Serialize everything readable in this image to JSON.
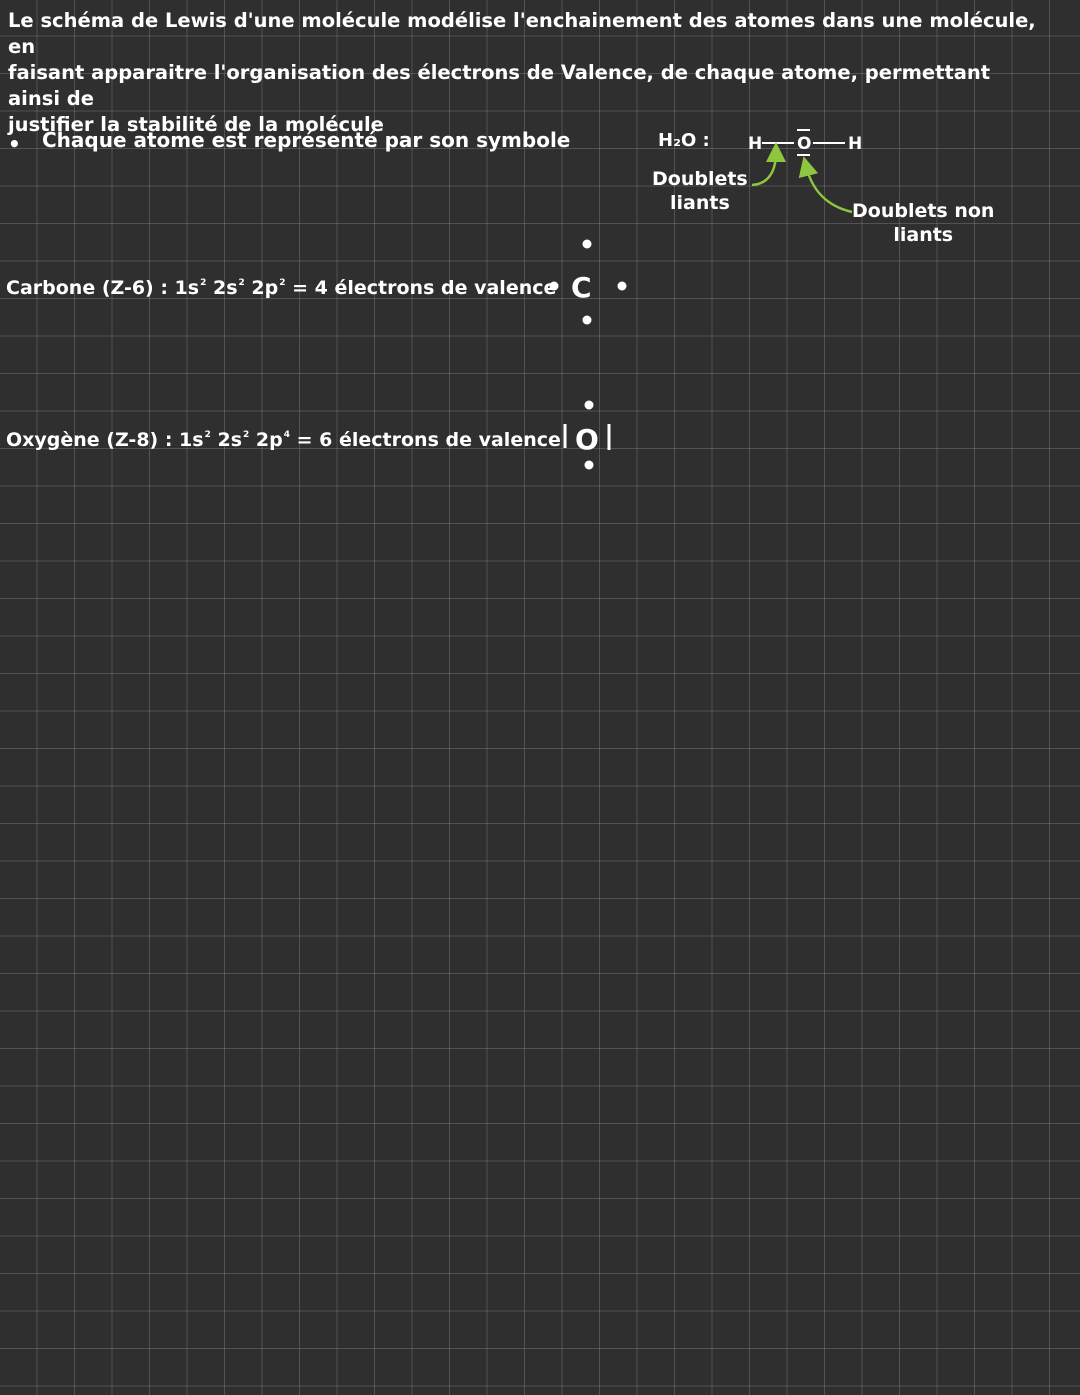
{
  "intro": {
    "line1": "Le schéma de Lewis d'une molécule modélise l'enchainement des atomes dans une molécule, en",
    "line2": "faisant apparaitre l'organisation des électrons de Valence, de chaque atome, permettant ainsi de",
    "line3": "justifier la stabilité de la molécule"
  },
  "bullet": {
    "marker": "•",
    "text": "Chaque atome est représenté par son symbole"
  },
  "h2o": {
    "formula": "H₂O :",
    "atom_left": "H",
    "atom_center": "O",
    "atom_right": "H",
    "bonding_label_line1": "Doublets",
    "bonding_label_line2": "liants",
    "lone_label_line1": "Doublets non",
    "lone_label_line2": "liants",
    "arrow_color": "#8dc63f"
  },
  "carbon": {
    "prefix": "Carbone (Z-6) : 1s",
    "e1": "2",
    "mid1": "2s",
    "e2": "2",
    "mid2": "2p",
    "e3": "2",
    "suffix": " = 4 électrons de valence",
    "symbol": "C"
  },
  "oxygen": {
    "prefix": "Oxygène (Z-8) : 1s",
    "e1": "2",
    "mid1": "2s",
    "e2": "2",
    "mid2": "2p",
    "e3": "4",
    "suffix": " = 6 électrons de valence",
    "symbol": "O"
  }
}
